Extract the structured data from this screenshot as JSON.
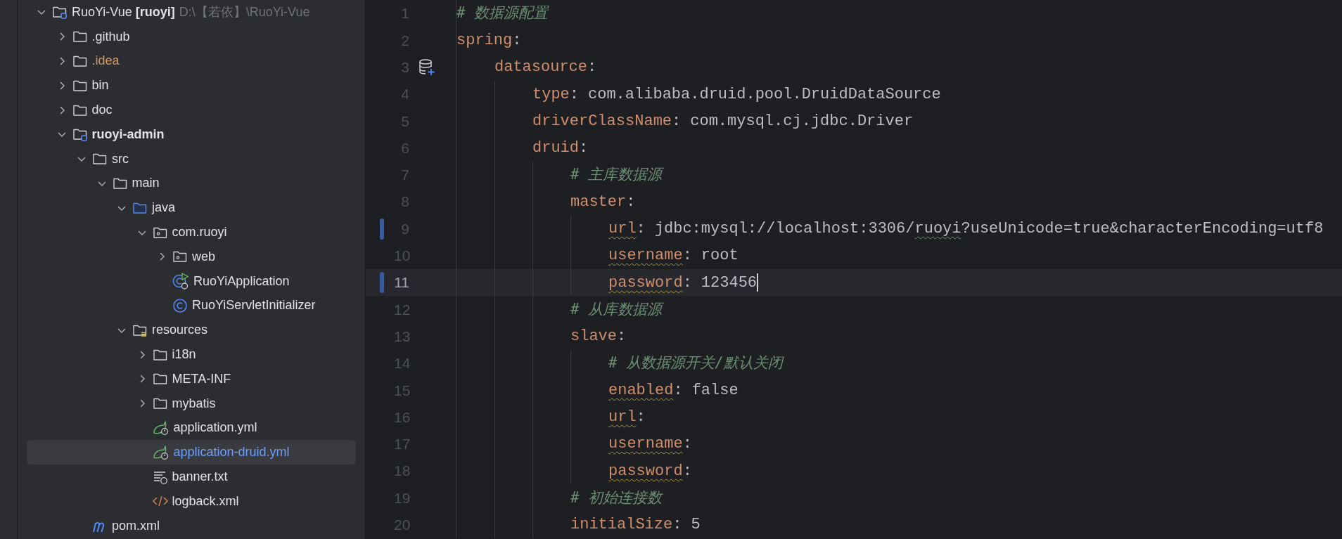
{
  "project_tree": {
    "items": [
      {
        "name": "RuoYi-Vue **[ruoyi]**",
        "path": "D:\\【若依】\\RuoYi-Vue",
        "kind": "module",
        "expanded": true,
        "selected": false,
        "color": "#dfe1e5",
        "children": [
          {
            "name": ".github",
            "kind": "folder",
            "expanded": false,
            "selected": false,
            "color": "#dfe1e5"
          },
          {
            "name": ".idea",
            "kind": "folder",
            "expanded": false,
            "selected": false,
            "color": "#d19a66"
          },
          {
            "name": "bin",
            "kind": "folder",
            "expanded": false,
            "selected": false,
            "color": "#dfe1e5"
          },
          {
            "name": "doc",
            "kind": "folder",
            "expanded": false,
            "selected": false,
            "color": "#dfe1e5"
          },
          {
            "name": "ruoyi-admin",
            "kind": "module",
            "bold": true,
            "expanded": true,
            "selected": false,
            "color": "#dfe1e5",
            "children": [
              {
                "name": "src",
                "kind": "folder",
                "expanded": true,
                "selected": false,
                "color": "#dfe1e5",
                "children": [
                  {
                    "name": "main",
                    "kind": "folder",
                    "expanded": true,
                    "selected": false,
                    "color": "#dfe1e5",
                    "children": [
                      {
                        "name": "java",
                        "kind": "source_folder",
                        "expanded": true,
                        "selected": false,
                        "color": "#dfe1e5",
                        "children": [
                          {
                            "name": "com.ruoyi",
                            "kind": "package",
                            "expanded": true,
                            "selected": false,
                            "color": "#dfe1e5",
                            "children": [
                              {
                                "name": "web",
                                "kind": "package",
                                "expanded": false,
                                "selected": false,
                                "color": "#dfe1e5"
                              },
                              {
                                "name": "RuoYiApplication",
                                "kind": "runnable_class",
                                "selected": false,
                                "color": "#dfe1e5"
                              },
                              {
                                "name": "RuoYiServletInitializer",
                                "kind": "class",
                                "selected": false,
                                "color": "#dfe1e5"
                              }
                            ]
                          }
                        ]
                      },
                      {
                        "name": "resources",
                        "kind": "resources_folder",
                        "expanded": true,
                        "selected": false,
                        "color": "#dfe1e5",
                        "children": [
                          {
                            "name": "i18n",
                            "kind": "folder",
                            "expanded": false,
                            "selected": false,
                            "color": "#dfe1e5"
                          },
                          {
                            "name": "META-INF",
                            "kind": "folder",
                            "expanded": false,
                            "selected": false,
                            "color": "#dfe1e5"
                          },
                          {
                            "name": "mybatis",
                            "kind": "folder",
                            "expanded": false,
                            "selected": false,
                            "color": "#dfe1e5"
                          },
                          {
                            "name": "application.yml",
                            "kind": "spring_config",
                            "selected": false,
                            "color": "#dfe1e5"
                          },
                          {
                            "name": "application-druid.yml",
                            "kind": "spring_config",
                            "selected": true,
                            "color": "#6f9ff5"
                          },
                          {
                            "name": "banner.txt",
                            "kind": "text_file",
                            "selected": false,
                            "color": "#dfe1e5"
                          },
                          {
                            "name": "logback.xml",
                            "kind": "xml_file",
                            "selected": false,
                            "color": "#dfe1e5"
                          }
                        ]
                      }
                    ]
                  }
                ]
              },
              {
                "name": "pom.xml",
                "kind": "maven_file",
                "selected": false,
                "color": "#dfe1e5"
              }
            ]
          }
        ]
      }
    ]
  },
  "editor": {
    "lines": [
      {
        "number": "1",
        "comment": "# 数据源配置"
      },
      {
        "number": "2",
        "key": "spring",
        "colon": ":",
        "children": [
          {
            "number": "3",
            "key": "datasource",
            "colon": ":",
            "gutter_icon": {
              "kind": "database"
            },
            "children": [
              {
                "number": "4",
                "key": "type",
                "colon": ":",
                "value": "com.alibaba.druid.pool.DruidDataSource"
              },
              {
                "number": "5",
                "key": "driverClassName",
                "colon": ":",
                "value": "com.mysql.cj.jdbc.Driver"
              },
              {
                "number": "6",
                "key": "druid",
                "colon": ":",
                "children": [
                  {
                    "number": "7",
                    "comment": "# 主库数据源"
                  },
                  {
                    "number": "8",
                    "key": "master",
                    "colon": ":",
                    "children": [
                      {
                        "number": "9",
                        "key": "url",
                        "colon": ":",
                        "warning": true,
                        "changed": true,
                        "value": [
                          {
                            "text": "jdbc:mysql://localhost:3306/",
                            "typo": false
                          },
                          {
                            "text": "ruoyi",
                            "typo": true
                          },
                          {
                            "text": "?useUnicode=true&characterEncoding=utf8",
                            "typo": false
                          }
                        ]
                      },
                      {
                        "number": "10",
                        "key": "username",
                        "colon": ":",
                        "warning": true,
                        "value": "root"
                      },
                      {
                        "number": "11",
                        "key": "password",
                        "colon": ":",
                        "warning": true,
                        "changed": true,
                        "current": true,
                        "value": "123456"
                      }
                    ]
                  },
                  {
                    "number": "12",
                    "comment": "# 从库数据源"
                  },
                  {
                    "number": "13",
                    "key": "slave",
                    "colon": ":",
                    "children": [
                      {
                        "number": "14",
                        "comment": "# 从数据源开关/默认关闭"
                      },
                      {
                        "number": "15",
                        "key": "enabled",
                        "colon": ":",
                        "warning": true,
                        "value": "false"
                      },
                      {
                        "number": "16",
                        "key": "url",
                        "colon": ":",
                        "warning": true
                      },
                      {
                        "number": "17",
                        "key": "username",
                        "colon": ":",
                        "warning": true
                      },
                      {
                        "number": "18",
                        "key": "password",
                        "colon": ":",
                        "warning": true
                      }
                    ]
                  },
                  {
                    "number": "19",
                    "comment": "# 初始连接数"
                  },
                  {
                    "number": "20",
                    "key": "initialSize",
                    "colon": ":",
                    "value": "5"
                  }
                ]
              }
            ]
          }
        ]
      }
    ]
  }
}
